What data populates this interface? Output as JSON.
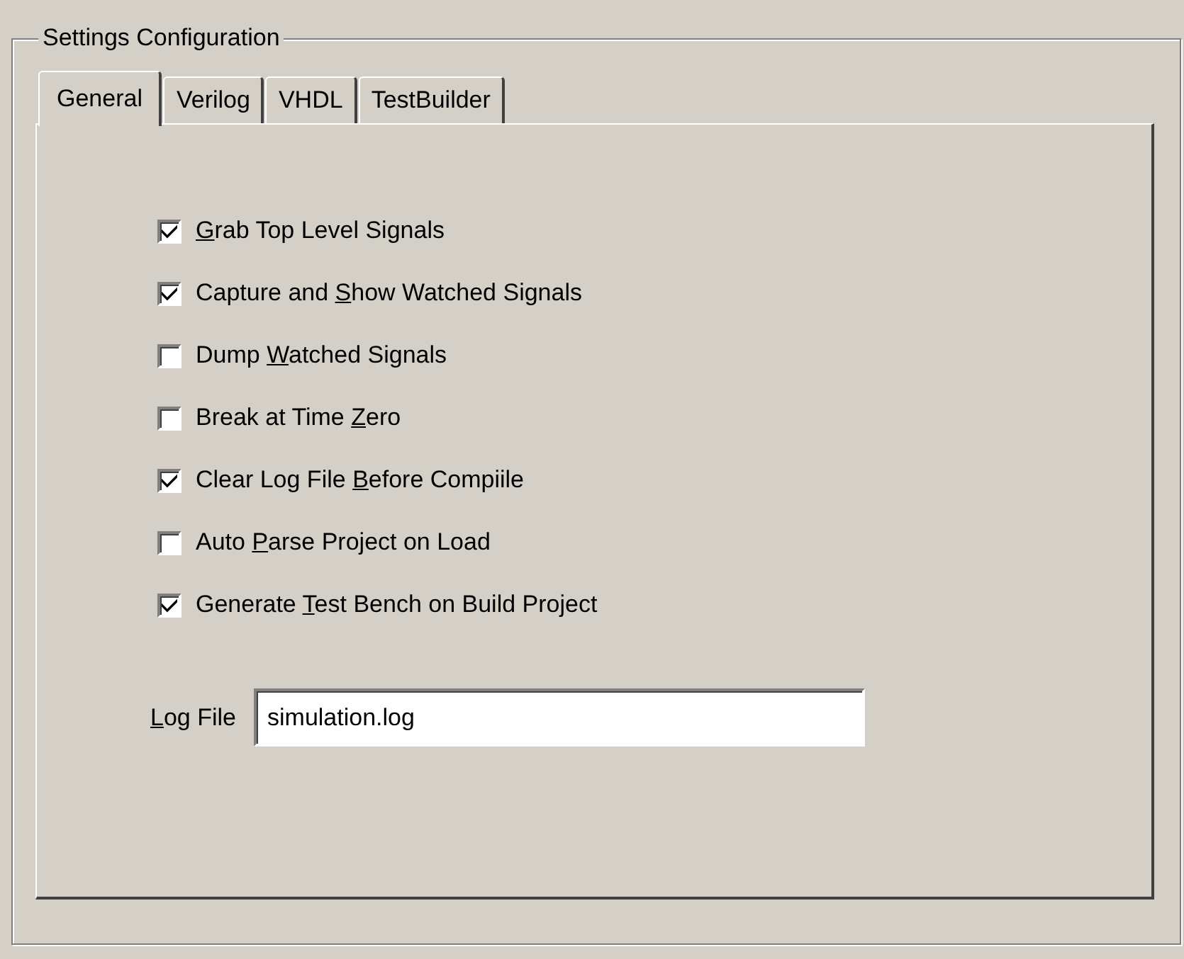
{
  "group": {
    "title": "Settings Configuration"
  },
  "tabs": [
    {
      "label": "General",
      "selected": true
    },
    {
      "label": "Verilog",
      "selected": false
    },
    {
      "label": "VHDL",
      "selected": false
    },
    {
      "label": "TestBuilder",
      "selected": false
    }
  ],
  "options": [
    {
      "segments": [
        {
          "text": "G",
          "underline": true
        },
        {
          "text": "rab Top Level Signals",
          "underline": false
        }
      ],
      "checked": true
    },
    {
      "segments": [
        {
          "text": "Capture and ",
          "underline": false
        },
        {
          "text": "S",
          "underline": true
        },
        {
          "text": "how Watched Signals",
          "underline": false
        }
      ],
      "checked": true
    },
    {
      "segments": [
        {
          "text": "Dump ",
          "underline": false
        },
        {
          "text": "W",
          "underline": true
        },
        {
          "text": "atched Signals",
          "underline": false
        }
      ],
      "checked": false
    },
    {
      "segments": [
        {
          "text": "Break at Time ",
          "underline": false
        },
        {
          "text": "Z",
          "underline": true
        },
        {
          "text": "ero",
          "underline": false
        }
      ],
      "checked": false
    },
    {
      "segments": [
        {
          "text": "Clear Log File ",
          "underline": false
        },
        {
          "text": "B",
          "underline": true
        },
        {
          "text": "efore Compiile",
          "underline": false
        }
      ],
      "checked": true
    },
    {
      "segments": [
        {
          "text": "Auto ",
          "underline": false
        },
        {
          "text": "P",
          "underline": true
        },
        {
          "text": "arse Project on Load",
          "underline": false
        }
      ],
      "checked": false
    },
    {
      "segments": [
        {
          "text": "Generate ",
          "underline": false
        },
        {
          "text": "T",
          "underline": true
        },
        {
          "text": "est Bench on Build Project",
          "underline": false
        }
      ],
      "checked": true
    }
  ],
  "log_file": {
    "segments": [
      {
        "text": "L",
        "underline": true
      },
      {
        "text": "og File",
        "underline": false
      }
    ],
    "value": "simulation.log"
  }
}
